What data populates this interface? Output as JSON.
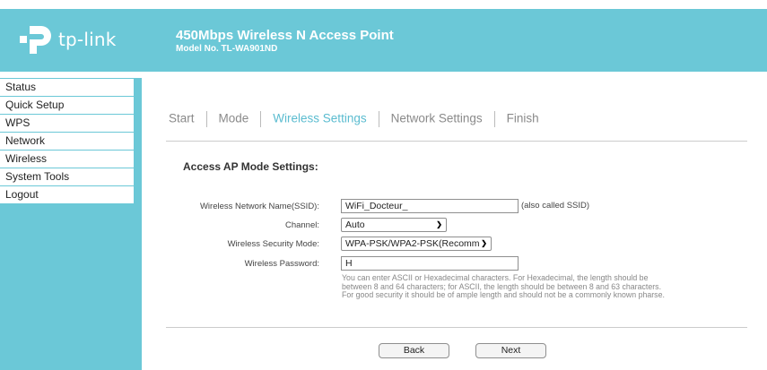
{
  "header": {
    "logo_text": "tp-link",
    "product_title": "450Mbps Wireless N Access Point",
    "model": "Model No. TL-WA901ND"
  },
  "sidebar": {
    "items": [
      {
        "label": "Status"
      },
      {
        "label": "Quick Setup"
      },
      {
        "label": "WPS"
      },
      {
        "label": "Network"
      },
      {
        "label": "Wireless"
      },
      {
        "label": "System Tools"
      },
      {
        "label": "Logout"
      }
    ]
  },
  "wizard": {
    "steps": [
      {
        "label": "Start"
      },
      {
        "label": "Mode"
      },
      {
        "label": "Wireless Settings"
      },
      {
        "label": "Network Settings"
      },
      {
        "label": "Finish"
      }
    ],
    "active_step": "Wireless Settings"
  },
  "form": {
    "section_title": "Access AP Mode Settings:",
    "ssid_label": "Wireless Network Name(SSID):",
    "ssid_value": "WiFi_Docteur_",
    "ssid_note": "(also called SSID)",
    "channel_label": "Channel:",
    "channel_value": "Auto",
    "security_label": "Wireless Security Mode:",
    "security_value": "WPA-PSK/WPA2-PSK(Recomm",
    "password_label": "Wireless Password:",
    "password_value": "H",
    "help_text": "You can enter ASCII or Hexadecimal characters. For Hexadecimal, the length should be between 8 and 64 characters; for ASCII, the length should be between 8 and 63 characters. For good security it should be of ample length and should not be a commonly known pharse."
  },
  "buttons": {
    "back": "Back",
    "next": "Next"
  },
  "colors": {
    "brand": "#6bc8d7",
    "active_step": "#5bbcd0"
  }
}
